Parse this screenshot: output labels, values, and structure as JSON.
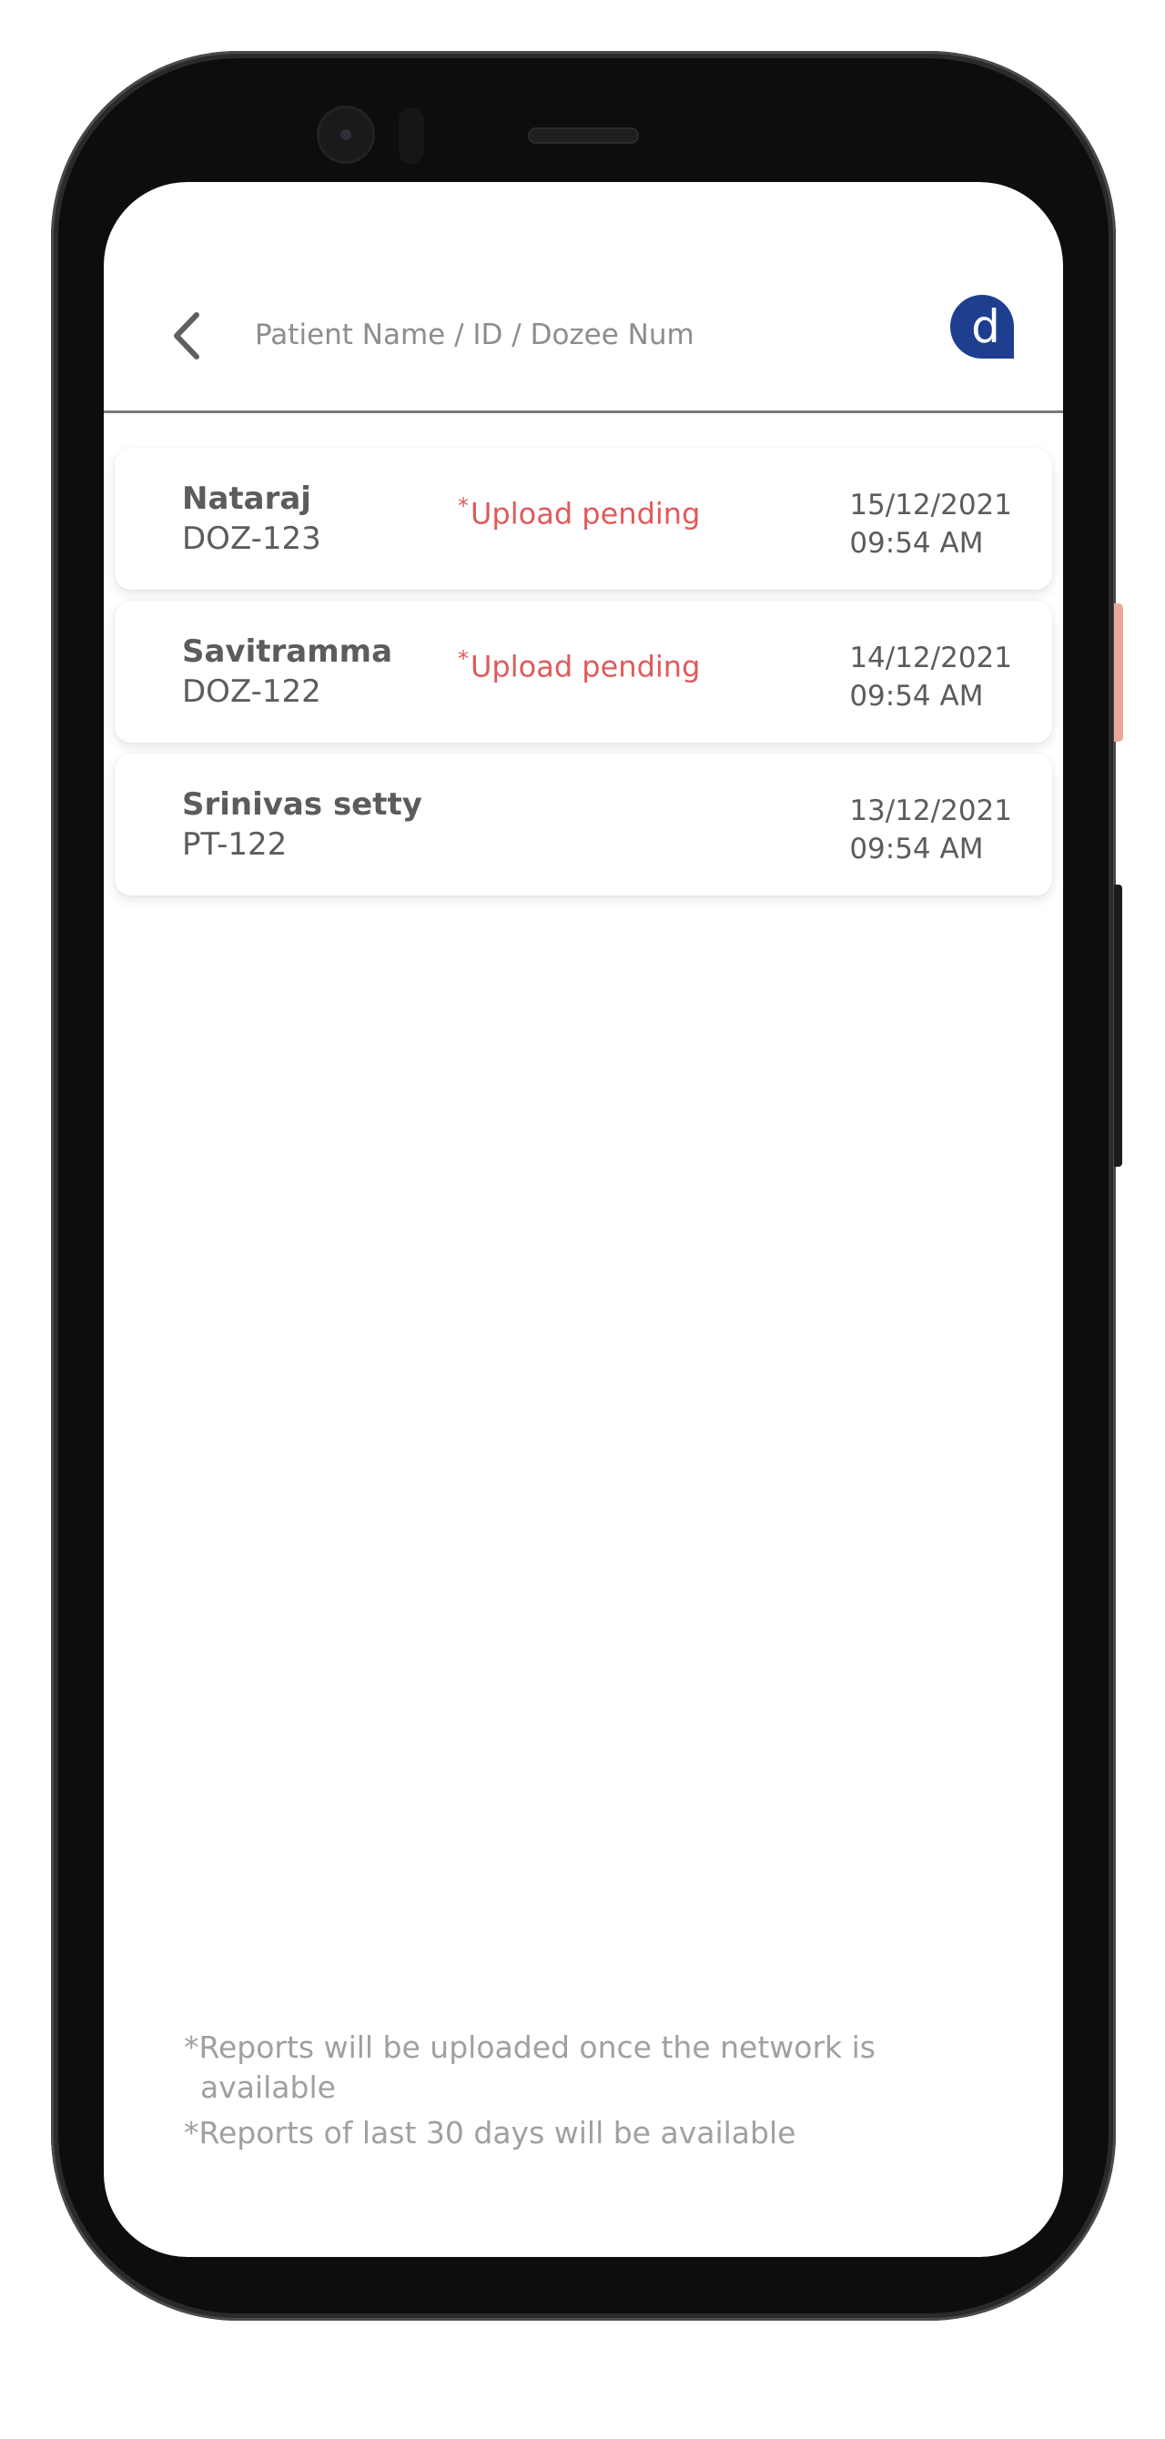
{
  "header": {
    "search_placeholder": "Patient Name / ID / Dozee Num",
    "avatar_letter": "d"
  },
  "patients": [
    {
      "name": "Nataraj",
      "id": "DOZ-123",
      "status": "Upload pending",
      "status_marker": "*",
      "date": "15/12/2021",
      "time": "09:54 AM"
    },
    {
      "name": "Savitramma",
      "id": "DOZ-122",
      "status": "Upload pending",
      "status_marker": "*",
      "date": "14/12/2021",
      "time": "09:54 AM"
    },
    {
      "name": "Srinivas setty",
      "id": "PT-122",
      "status": "",
      "status_marker": "",
      "date": "13/12/2021",
      "time": "09:54 AM"
    }
  ],
  "footer": {
    "note_network": "*Reports will be uploaded once the network is available",
    "note_days": "*Reports of last 30 days will be available"
  },
  "colors": {
    "accent": "#1e3f8f",
    "pending": "#e05a5a",
    "text": "#5c5c5c",
    "muted": "#a0a0a0"
  },
  "icons": {
    "back": "chevron-left-icon"
  }
}
